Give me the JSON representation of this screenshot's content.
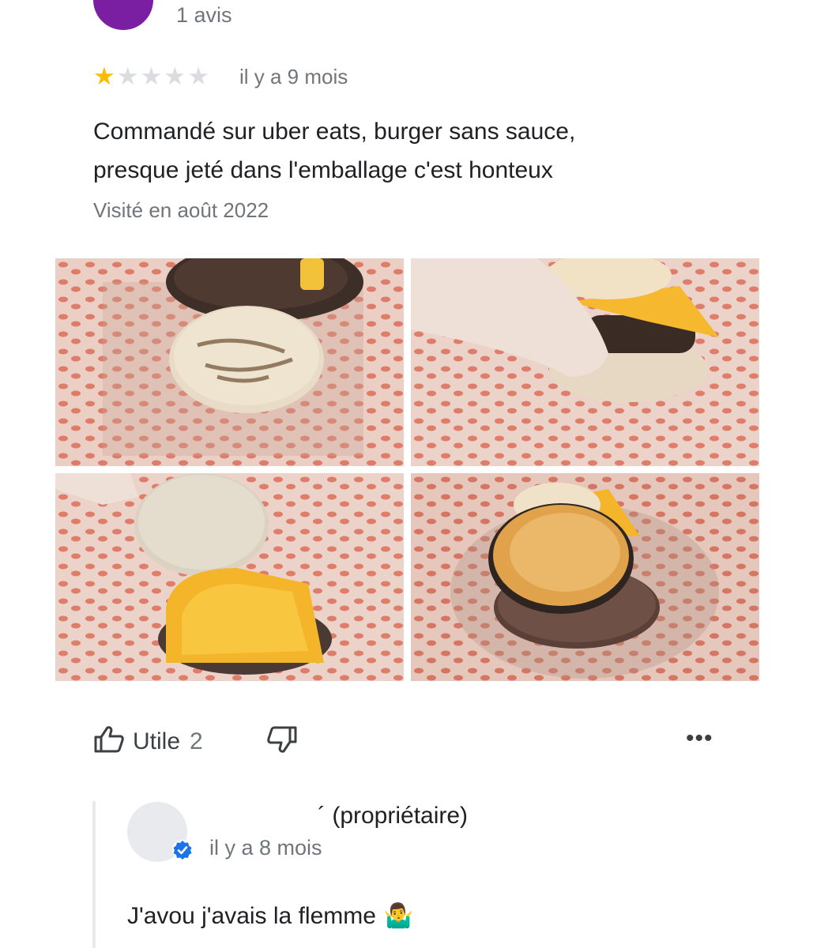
{
  "reviewer": {
    "review_count": "1 avis",
    "avatar_color": "#7b1fa2"
  },
  "review": {
    "rating": 1,
    "max_rating": 5,
    "date": "il y a 9 mois",
    "text_line1": "Commandé sur uber eats, burger sans sauce,",
    "text_line2": "presque jeté dans l'emballage c'est honteux",
    "visited": "Visité en août 2022"
  },
  "photos": [
    {
      "icon": "photo-bun-patty"
    },
    {
      "icon": "photo-hand-burger"
    },
    {
      "icon": "photo-bun-cheese"
    },
    {
      "icon": "photo-burned-burger"
    }
  ],
  "actions": {
    "like_label": "Utile",
    "like_count": "2",
    "more_label": "•••"
  },
  "owner_reply": {
    "name": "´ (propriétaire)",
    "date": "il y a 8 mois",
    "text": "J'avou j'avais la flemme",
    "emoji": "🤷‍♂️"
  },
  "colors": {
    "star_on": "#fbbc04",
    "star_off": "#dadce0",
    "verified": "#1a73e8"
  }
}
